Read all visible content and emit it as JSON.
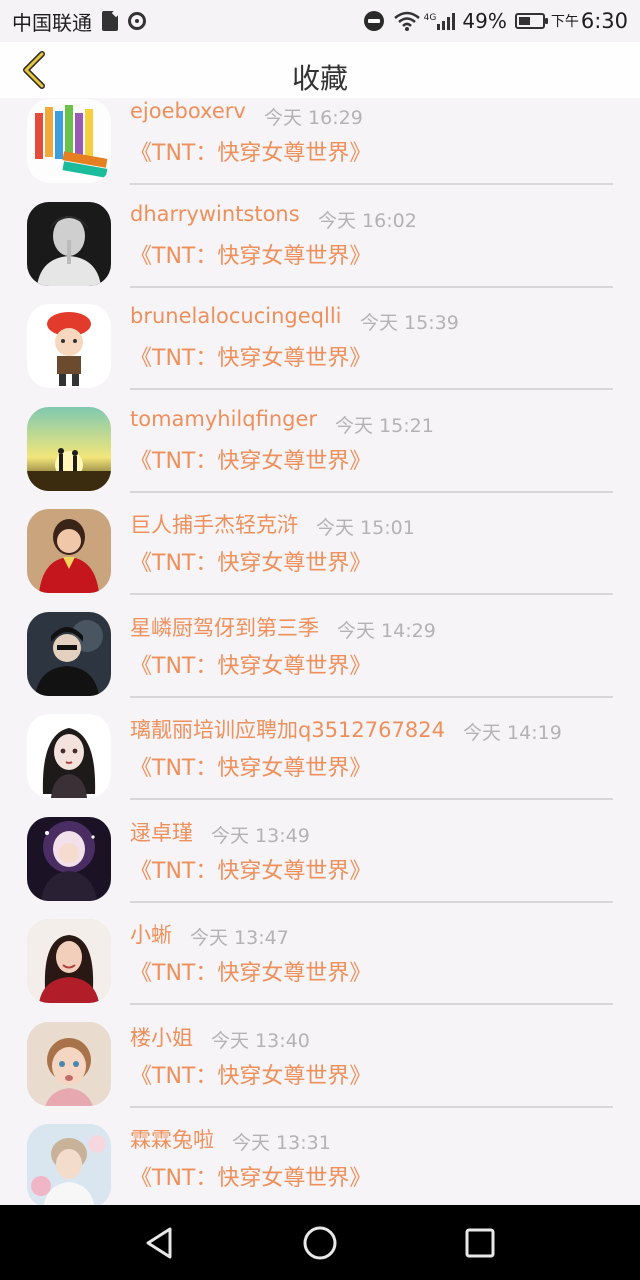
{
  "status_bar": {
    "carrier": "中国联通",
    "network": "4G",
    "battery": "49%",
    "battery_level": 0.49,
    "time_prefix": "下午",
    "time": "6:30",
    "icons": [
      "sd-card-icon",
      "hotspot-icon",
      "do-not-disturb-icon",
      "wifi-icon",
      "signal-icon",
      "battery-icon"
    ]
  },
  "header": {
    "title": "收藏",
    "back_icon": "chevron-left-icon",
    "accent_color": "#e8c53a"
  },
  "list": {
    "accent_color": "#ee905c",
    "items": [
      {
        "user": "ejoeboxerv",
        "time": "今天 16:29",
        "title": "《TNT：快穿女尊世界》",
        "avatar": "crayons"
      },
      {
        "user": "dharrywintstons",
        "time": "今天 16:02",
        "title": "《TNT：快穿女尊世界》",
        "avatar": "bw-portrait"
      },
      {
        "user": "brunelalocucingeqlli",
        "time": "今天 15:39",
        "title": "《TNT：快穿女尊世界》",
        "avatar": "cartoon-red-hat"
      },
      {
        "user": "tomamyhilqfinger",
        "time": "今天 15:21",
        "title": "《TNT：快穿女尊世界》",
        "avatar": "sunset-couple"
      },
      {
        "user": "巨人捕手杰轻克浒",
        "time": "今天 15:01",
        "title": "《TNT：快穿女尊世界》",
        "avatar": "woman-red-dress"
      },
      {
        "user": "星嶙厨驾伢到第三季",
        "time": "今天 14:29",
        "title": "《TNT：快穿女尊世界》",
        "avatar": "dark-smoke"
      },
      {
        "user": "璃靓丽培训应聘加q3512767824",
        "time": "今天 14:19",
        "title": "《TNT：快穿女尊世界》",
        "avatar": "anime-girl"
      },
      {
        "user": "逯卓瑾",
        "time": "今天 13:49",
        "title": "《TNT：快穿女尊世界》",
        "avatar": "stage-singer"
      },
      {
        "user": "小蜥",
        "time": "今天 13:47",
        "title": "《TNT：快穿女尊世界》",
        "avatar": "woman-smile"
      },
      {
        "user": "楼小姐",
        "time": "今天 13:40",
        "title": "《TNT：快穿女尊世界》",
        "avatar": "child"
      },
      {
        "user": "霖霖兔啦",
        "time": "今天 13:31",
        "title": "《TNT：快穿女尊世界》",
        "avatar": "boy-flowers"
      }
    ]
  },
  "nav_bar": {
    "buttons": [
      "back-triangle-icon",
      "home-circle-icon",
      "recents-square-icon"
    ]
  }
}
